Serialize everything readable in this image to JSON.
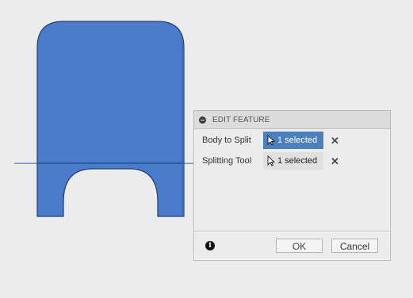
{
  "dialog": {
    "title": "EDIT FEATURE",
    "rows": [
      {
        "label": "Body to Split",
        "value": "1 selected",
        "state": "active"
      },
      {
        "label": "Splitting Tool",
        "value": "1 selected",
        "state": "inactive"
      }
    ],
    "ok_label": "OK",
    "cancel_label": "Cancel",
    "clear_glyph": "✕",
    "info_glyph": "i"
  },
  "colors": {
    "body_fill": "#4a7cc9",
    "body_stroke": "#1f3f77",
    "active_field": "#4b7fbe",
    "background": "#ececec"
  },
  "icons": [
    "collapse-icon",
    "cursor-arrow-icon",
    "close-icon",
    "info-icon"
  ]
}
